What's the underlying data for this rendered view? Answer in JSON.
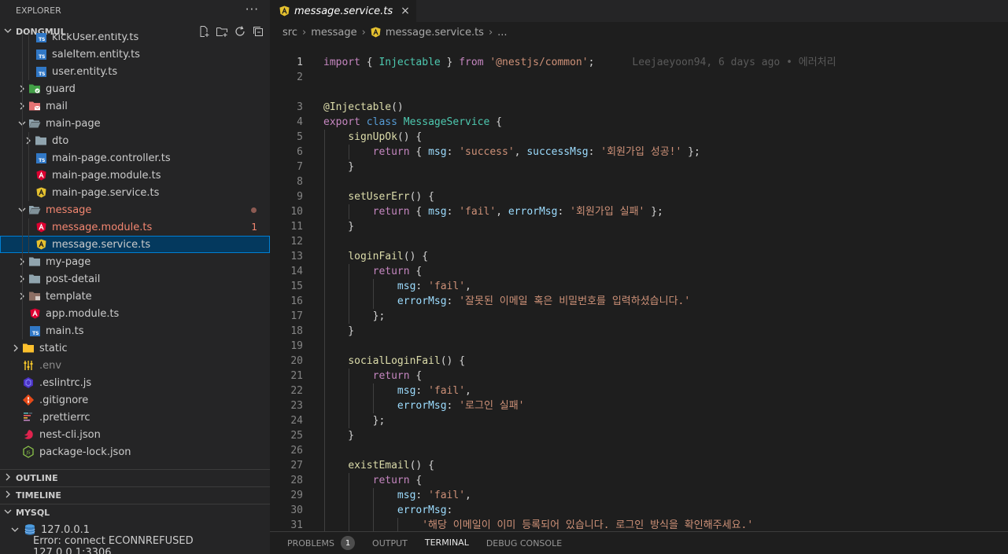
{
  "sidebar": {
    "explorer_title": "EXPLORER",
    "more_label": "···",
    "project_name": "DONGMUL",
    "tree": [
      {
        "label": "kickUser.entity.ts",
        "depth": 3,
        "type": "ts"
      },
      {
        "label": "saleItem.entity.ts",
        "depth": 3,
        "type": "ts"
      },
      {
        "label": "user.entity.ts",
        "depth": 3,
        "type": "ts"
      },
      {
        "label": "guard",
        "depth": 2,
        "type": "folder-guard",
        "expanded": false
      },
      {
        "label": "mail",
        "depth": 2,
        "type": "folder-mail",
        "expanded": false
      },
      {
        "label": "main-page",
        "depth": 2,
        "type": "folder-open",
        "expanded": true
      },
      {
        "label": "dto",
        "depth": 3,
        "type": "folder",
        "expanded": false
      },
      {
        "label": "main-page.controller.ts",
        "depth": 3,
        "type": "ts"
      },
      {
        "label": "main-page.module.ts",
        "depth": 3,
        "type": "ng-red"
      },
      {
        "label": "main-page.service.ts",
        "depth": 3,
        "type": "ng-yellow"
      },
      {
        "label": "message",
        "depth": 2,
        "type": "folder-open",
        "expanded": true,
        "status": "error-dot"
      },
      {
        "label": "message.module.ts",
        "depth": 3,
        "type": "ng-red",
        "status": "error",
        "count": "1"
      },
      {
        "label": "message.service.ts",
        "depth": 3,
        "type": "ng-yellow",
        "selected": true
      },
      {
        "label": "my-page",
        "depth": 2,
        "type": "folder",
        "expanded": false
      },
      {
        "label": "post-detail",
        "depth": 2,
        "type": "folder",
        "expanded": false
      },
      {
        "label": "template",
        "depth": 2,
        "type": "folder-template",
        "expanded": false
      },
      {
        "label": "app.module.ts",
        "depth": 2,
        "type": "ng-red"
      },
      {
        "label": "main.ts",
        "depth": 2,
        "type": "ts"
      },
      {
        "label": "static",
        "depth": 1,
        "type": "folder-static",
        "expanded": false
      },
      {
        "label": ".env",
        "depth": 1,
        "type": "env",
        "dim": true
      },
      {
        "label": ".eslintrc.js",
        "depth": 1,
        "type": "eslint"
      },
      {
        "label": ".gitignore",
        "depth": 1,
        "type": "git"
      },
      {
        "label": ".prettierrc",
        "depth": 1,
        "type": "prettier"
      },
      {
        "label": "nest-cli.json",
        "depth": 1,
        "type": "nest"
      },
      {
        "label": "package-lock.json",
        "depth": 1,
        "type": "node"
      }
    ],
    "outline_label": "OUTLINE",
    "timeline_label": "TIMELINE",
    "mysql_label": "MYSQL",
    "mysql_host": "127.0.0.1",
    "mysql_error": "Error: connect ECONNREFUSED 127.0.0.1:3306"
  },
  "editor": {
    "tab_label": "message.service.ts",
    "tab_close": "×",
    "breadcrumb": [
      "src",
      "message",
      "message.service.ts",
      "..."
    ],
    "blame": "Leejaeyoon94, 6 days ago • 에러처리",
    "lines": [
      {
        "n": "1",
        "t": [
          [
            "kw2",
            "import"
          ],
          [
            "plain",
            " { "
          ],
          [
            "cls",
            "Injectable"
          ],
          [
            "plain",
            " } "
          ],
          [
            "kw2",
            "from"
          ],
          [
            "plain",
            " "
          ],
          [
            "str",
            "'@nestjs/common'"
          ],
          [
            "plain",
            ";"
          ]
        ],
        "blame": true,
        "current": true
      },
      {
        "n": "2",
        "t": []
      },
      {
        "n": "",
        "t": []
      },
      {
        "n": "3",
        "t": [
          [
            "fn",
            "@Injectable"
          ],
          [
            "plain",
            "()"
          ]
        ]
      },
      {
        "n": "4",
        "t": [
          [
            "kw2",
            "export"
          ],
          [
            "plain",
            " "
          ],
          [
            "kw",
            "class"
          ],
          [
            "plain",
            " "
          ],
          [
            "cls",
            "MessageService"
          ],
          [
            "plain",
            " {"
          ]
        ]
      },
      {
        "n": "5",
        "t": [
          [
            "plain",
            "    "
          ],
          [
            "fn",
            "signUpOk"
          ],
          [
            "plain",
            "() {"
          ]
        ],
        "g": [
          1
        ]
      },
      {
        "n": "6",
        "t": [
          [
            "plain",
            "        "
          ],
          [
            "kw2",
            "return"
          ],
          [
            "plain",
            " { "
          ],
          [
            "prop",
            "msg"
          ],
          [
            "plain",
            ": "
          ],
          [
            "str",
            "'success'"
          ],
          [
            "plain",
            ", "
          ],
          [
            "prop",
            "successMsg"
          ],
          [
            "plain",
            ": "
          ],
          [
            "str",
            "'회원가입 성공!'"
          ],
          [
            "plain",
            " };"
          ]
        ],
        "g": [
          1,
          2
        ]
      },
      {
        "n": "7",
        "t": [
          [
            "plain",
            "    }"
          ]
        ],
        "g": [
          1
        ]
      },
      {
        "n": "8",
        "t": [],
        "g": [
          1
        ]
      },
      {
        "n": "9",
        "t": [
          [
            "plain",
            "    "
          ],
          [
            "fn",
            "setUserErr"
          ],
          [
            "plain",
            "() {"
          ]
        ],
        "g": [
          1
        ]
      },
      {
        "n": "10",
        "t": [
          [
            "plain",
            "        "
          ],
          [
            "kw2",
            "return"
          ],
          [
            "plain",
            " { "
          ],
          [
            "prop",
            "msg"
          ],
          [
            "plain",
            ": "
          ],
          [
            "str",
            "'fail'"
          ],
          [
            "plain",
            ", "
          ],
          [
            "prop",
            "errorMsg"
          ],
          [
            "plain",
            ": "
          ],
          [
            "str",
            "'회원가입 실패'"
          ],
          [
            "plain",
            " };"
          ]
        ],
        "g": [
          1,
          2
        ]
      },
      {
        "n": "11",
        "t": [
          [
            "plain",
            "    }"
          ]
        ],
        "g": [
          1
        ]
      },
      {
        "n": "12",
        "t": [],
        "g": [
          1
        ]
      },
      {
        "n": "13",
        "t": [
          [
            "plain",
            "    "
          ],
          [
            "fn",
            "loginFail"
          ],
          [
            "plain",
            "() {"
          ]
        ],
        "g": [
          1
        ]
      },
      {
        "n": "14",
        "t": [
          [
            "plain",
            "        "
          ],
          [
            "kw2",
            "return"
          ],
          [
            "plain",
            " {"
          ]
        ],
        "g": [
          1,
          2
        ]
      },
      {
        "n": "15",
        "t": [
          [
            "plain",
            "            "
          ],
          [
            "prop",
            "msg"
          ],
          [
            "plain",
            ": "
          ],
          [
            "str",
            "'fail'"
          ],
          [
            "plain",
            ","
          ]
        ],
        "g": [
          1,
          2,
          3
        ]
      },
      {
        "n": "16",
        "t": [
          [
            "plain",
            "            "
          ],
          [
            "prop",
            "errorMsg"
          ],
          [
            "plain",
            ": "
          ],
          [
            "str",
            "'잘못된 이메일 혹은 비밀번호를 입력하셨습니다.'"
          ]
        ],
        "g": [
          1,
          2,
          3
        ]
      },
      {
        "n": "17",
        "t": [
          [
            "plain",
            "        };"
          ]
        ],
        "g": [
          1,
          2
        ]
      },
      {
        "n": "18",
        "t": [
          [
            "plain",
            "    }"
          ]
        ],
        "g": [
          1
        ]
      },
      {
        "n": "19",
        "t": [],
        "g": [
          1
        ]
      },
      {
        "n": "20",
        "t": [
          [
            "plain",
            "    "
          ],
          [
            "fn",
            "socialLoginFail"
          ],
          [
            "plain",
            "() {"
          ]
        ],
        "g": [
          1
        ]
      },
      {
        "n": "21",
        "t": [
          [
            "plain",
            "        "
          ],
          [
            "kw2",
            "return"
          ],
          [
            "plain",
            " {"
          ]
        ],
        "g": [
          1,
          2
        ]
      },
      {
        "n": "22",
        "t": [
          [
            "plain",
            "            "
          ],
          [
            "prop",
            "msg"
          ],
          [
            "plain",
            ": "
          ],
          [
            "str",
            "'fail'"
          ],
          [
            "plain",
            ","
          ]
        ],
        "g": [
          1,
          2,
          3
        ]
      },
      {
        "n": "23",
        "t": [
          [
            "plain",
            "            "
          ],
          [
            "prop",
            "errorMsg"
          ],
          [
            "plain",
            ": "
          ],
          [
            "str",
            "'로그인 실패'"
          ]
        ],
        "g": [
          1,
          2,
          3
        ]
      },
      {
        "n": "24",
        "t": [
          [
            "plain",
            "        };"
          ]
        ],
        "g": [
          1,
          2
        ]
      },
      {
        "n": "25",
        "t": [
          [
            "plain",
            "    }"
          ]
        ],
        "g": [
          1
        ]
      },
      {
        "n": "26",
        "t": [],
        "g": [
          1
        ]
      },
      {
        "n": "27",
        "t": [
          [
            "plain",
            "    "
          ],
          [
            "fn",
            "existEmail"
          ],
          [
            "plain",
            "() {"
          ]
        ],
        "g": [
          1
        ]
      },
      {
        "n": "28",
        "t": [
          [
            "plain",
            "        "
          ],
          [
            "kw2",
            "return"
          ],
          [
            "plain",
            " {"
          ]
        ],
        "g": [
          1,
          2
        ]
      },
      {
        "n": "29",
        "t": [
          [
            "plain",
            "            "
          ],
          [
            "prop",
            "msg"
          ],
          [
            "plain",
            ": "
          ],
          [
            "str",
            "'fail'"
          ],
          [
            "plain",
            ","
          ]
        ],
        "g": [
          1,
          2,
          3
        ]
      },
      {
        "n": "30",
        "t": [
          [
            "plain",
            "            "
          ],
          [
            "prop",
            "errorMsg"
          ],
          [
            "plain",
            ":"
          ]
        ],
        "g": [
          1,
          2,
          3
        ]
      },
      {
        "n": "31",
        "t": [
          [
            "plain",
            "                "
          ],
          [
            "str",
            "'해당 이메일이 이미 등록되어 있습니다. 로그인 방식을 확인해주세요.'"
          ]
        ],
        "g": [
          1,
          2,
          3,
          4
        ]
      }
    ]
  },
  "panel": {
    "tabs": [
      {
        "label": "PROBLEMS",
        "badge": "1",
        "active": false
      },
      {
        "label": "OUTPUT",
        "active": false
      },
      {
        "label": "TERMINAL",
        "active": true
      },
      {
        "label": "DEBUG CONSOLE",
        "active": false
      }
    ]
  },
  "colors": {
    "accent": "#007fd4",
    "error": "#f48771",
    "ts_blue": "#3178c6",
    "angular_red": "#dd0031",
    "angular_yellow": "#e5c12f"
  }
}
